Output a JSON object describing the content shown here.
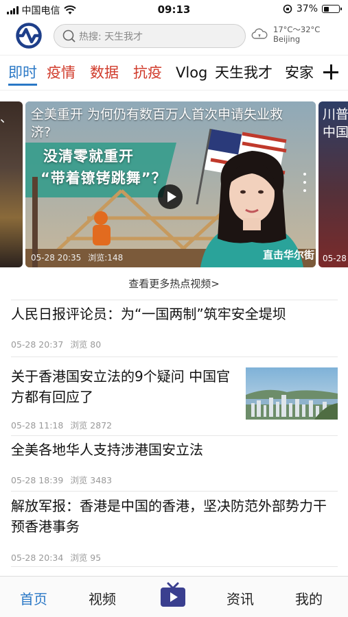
{
  "status_bar": {
    "carrier": "中国电信",
    "time": "09:13",
    "battery": "37%",
    "battery_level": 0.37
  },
  "header": {
    "logo_icon": "circle-wave-logo",
    "search_placeholder": "热搜: 天生我才",
    "weather": {
      "icon": "cloud-icon",
      "temp": "17°C～32°C",
      "city": "Beijing"
    }
  },
  "tabs": [
    "即时",
    "疫情",
    "数据",
    "抗疫",
    "Vlog",
    "天生我才",
    "安家"
  ],
  "active_tab": 0,
  "videos": {
    "left_snippet": "、",
    "main": {
      "title": "全美重开 为何仍有数百万人首次申请失业救济?",
      "overlay_line1": "没清零就重开",
      "overlay_line2": "“带着镣铐跳舞”？",
      "date": "05-28 20:35",
      "views": "浏览:148",
      "watermark": "直击华尔街"
    },
    "right": {
      "title_line1": "川普",
      "title_line2": "中国",
      "date": "05-28"
    },
    "more_link": "查看更多热点视频>"
  },
  "news": [
    {
      "headline": "人民日报评论员：为“一国两制”筑牢安全堤坝",
      "date": "05-28 20:37",
      "views": "浏览 80"
    },
    {
      "headline": "关于香港国安立法的9个疑问 中国官方都有回应了",
      "date": "05-28 11:18",
      "views": "浏览 2872"
    },
    {
      "headline": "全美各地华人支持涉港国安立法",
      "date": "05-28 18:39",
      "views": "浏览 3483"
    },
    {
      "headline": "解放军报：香港是中国的香港，坚决防范外部势力干预香港事务",
      "date": "05-28 20:34",
      "views": "浏览 95"
    }
  ],
  "bottom_nav": {
    "items": [
      "首页",
      "视频",
      "资讯",
      "我的"
    ],
    "center_icon": "tv-icon",
    "active": 0
  },
  "colors": {
    "accent": "#2a78c6",
    "tab_red": "#d03a2a",
    "logo": "#1e3f8a",
    "tv_button": "#3a3f8f"
  }
}
